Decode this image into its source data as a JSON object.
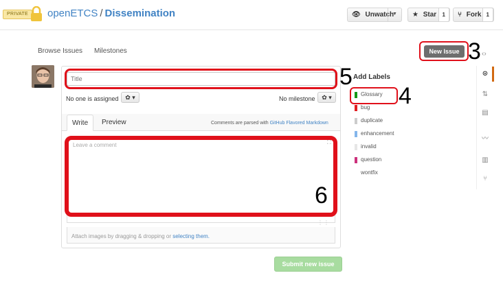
{
  "header": {
    "private_badge": "PRIVATE",
    "owner": "openETCS",
    "separator": "/",
    "repo": "Dissemination",
    "unwatch_label": "Unwatch",
    "star_label": "Star",
    "star_count": "1",
    "fork_label": "Fork",
    "fork_count": "1"
  },
  "subnav": {
    "browse_issues": "Browse Issues",
    "milestones": "Milestones",
    "new_issue": "New Issue"
  },
  "form": {
    "title_placeholder": "Title",
    "assignee_text": "No one is assigned",
    "milestone_text": "No milestone",
    "tab_write": "Write",
    "tab_preview": "Preview",
    "parsed_prefix": "Comments are parsed with",
    "parsed_link": "GitHub Flavored Markdown",
    "comment_placeholder": "Leave a comment",
    "attach_prefix": "Attach images by dragging & dropping or",
    "attach_link": "selecting them.",
    "submit_label": "Submit new issue"
  },
  "labels": {
    "title": "Add Labels",
    "items": [
      {
        "name": "Glossary",
        "color": "#159818"
      },
      {
        "name": "bug",
        "color": "#e11d21"
      },
      {
        "name": "duplicate",
        "color": "#cccccc"
      },
      {
        "name": "enhancement",
        "color": "#84b6eb"
      },
      {
        "name": "invalid",
        "color": "#e6e6e6"
      },
      {
        "name": "question",
        "color": "#cc317c"
      },
      {
        "name": "wontfix",
        "color": "#ffffff"
      }
    ]
  },
  "annotations": {
    "n3": "3",
    "n4": "4",
    "n5": "5",
    "n6": "6"
  },
  "colors": {
    "link": "#4183c4",
    "highlight": "#e0101a",
    "submit": "#a8dca0"
  }
}
